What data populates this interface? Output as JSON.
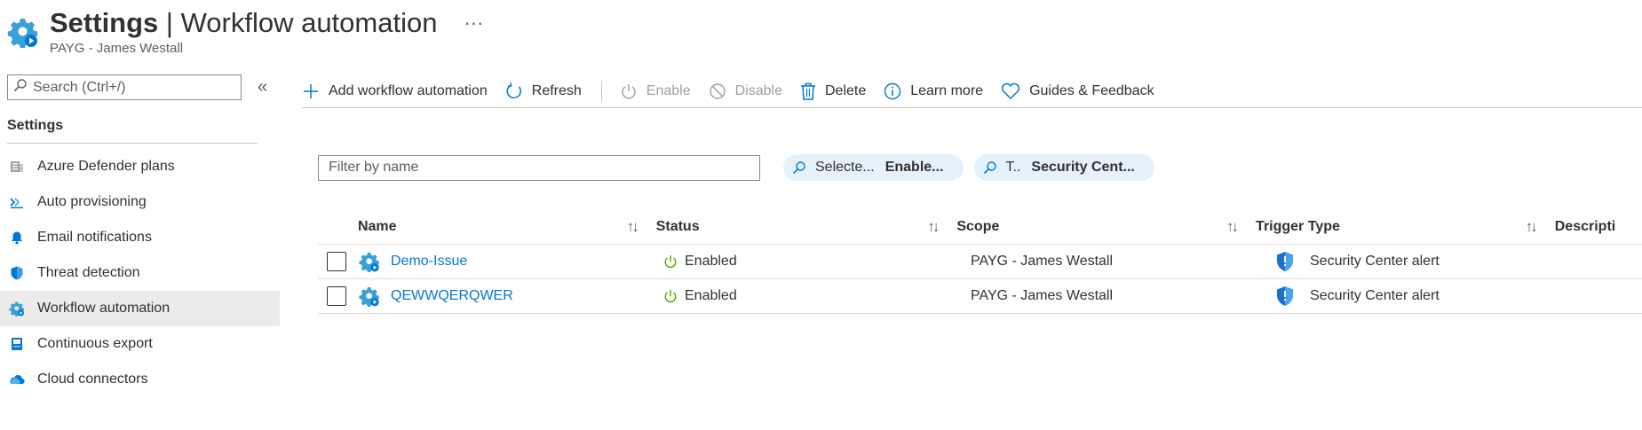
{
  "header": {
    "title_strong": "Settings",
    "title_rest": " | Workflow automation",
    "subtitle": "PAYG - James Westall",
    "more": "···"
  },
  "sidebar": {
    "search_placeholder": "Search (Ctrl+/)",
    "collapse": "«",
    "heading": "Settings",
    "items": [
      {
        "label": "Azure Defender plans",
        "icon": "defender-plans-icon"
      },
      {
        "label": "Auto provisioning",
        "icon": "auto-provisioning-icon"
      },
      {
        "label": "Email notifications",
        "icon": "bell-icon"
      },
      {
        "label": "Threat detection",
        "icon": "shield-icon"
      },
      {
        "label": "Workflow automation",
        "icon": "gear-icon",
        "active": true
      },
      {
        "label": "Continuous export",
        "icon": "export-icon"
      },
      {
        "label": "Cloud connectors",
        "icon": "cloud-icon"
      }
    ]
  },
  "toolbar": {
    "add": "Add workflow automation",
    "refresh": "Refresh",
    "enable": "Enable",
    "disable": "Disable",
    "delete": "Delete",
    "learn": "Learn more",
    "guides": "Guides & Feedback"
  },
  "filters": {
    "name_placeholder": "Filter by name",
    "pill1_label": "Selecte...",
    "pill1_value": "Enable...",
    "pill2_label": "T..",
    "pill2_value": "Security Cent..."
  },
  "table": {
    "headers": [
      "Name",
      "Status",
      "Scope",
      "Trigger Type",
      "Descripti"
    ],
    "sort_glyph": "↑↓",
    "rows": [
      {
        "name": "Demo-Issue",
        "status": "Enabled",
        "scope": "PAYG - James Westall",
        "trigger": "Security Center alert"
      },
      {
        "name": "QEWWQERQWER",
        "status": "Enabled",
        "scope": "PAYG - James Westall",
        "trigger": "Security Center alert"
      }
    ]
  },
  "colors": {
    "accent": "#0078d4",
    "status_green": "#57a300",
    "nav_active_bg": "#edebe9",
    "pill_bg": "#e5f1fb"
  }
}
